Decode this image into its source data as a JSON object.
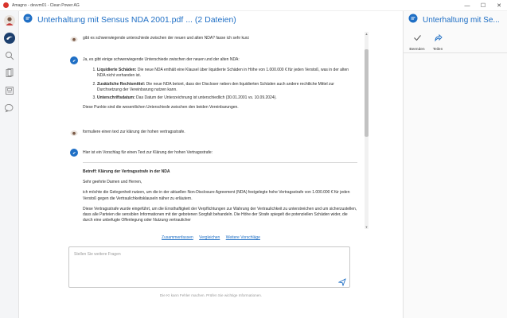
{
  "window": {
    "title": "Amagno - devvm01 - Clean Power AG",
    "controls": {
      "minimize": "—",
      "maximize": "☐",
      "close": "✕"
    }
  },
  "leftnav": {
    "items": [
      {
        "name": "avatar"
      },
      {
        "name": "amagno-logo-icon"
      },
      {
        "name": "search-icon"
      },
      {
        "name": "documents-icon"
      },
      {
        "name": "scanner-icon"
      },
      {
        "name": "chat-icon"
      }
    ]
  },
  "chat": {
    "title": "Unterhaltung mit Sensus NDA 2001.pdf ... (2 Dateien)",
    "messages": {
      "user1": "gibt es schwerwiegende unterschiede zwischen der neuen und alten NDA? fasse ich sehr kurz",
      "bot1_intro": "Ja, es gibt einige schwerwiegende Unterschiede zwischen der neuen und der alten NDA:",
      "bot1_items": [
        {
          "label": "Liquidierte Schäden:",
          "text": " Die neue NDA enthält eine Klausel über liquidierte Schäden in Höhe von 1.000.000 € für jeden Verstoß, was in der alten NDA nicht vorhanden ist."
        },
        {
          "label": "Zusätzliche Rechtsmittel:",
          "text": " Die neue NDA betont, dass der Discloser neben den liquidierten Schäden auch andere rechtliche Mittel zur Durchsetzung der Vereinbarung nutzen kann."
        },
        {
          "label": "Unterschriftsdatum:",
          "text": " Das Datum der Unterzeichnung ist unterschiedlich (30.01.2001 vs. 10.09.2024)."
        }
      ],
      "bot1_outro": "Diese Punkte sind die wesentlichen Unterschiede zwischen den beiden Vereinbarungen.",
      "user2": "formuliere einen text zur klärung der hohen vertragsstrafe.",
      "bot2_intro": "Hier ist ein Vorschlag für einen Text zur Klärung der hohen Vertragsstrafe:",
      "letter_subject": "Betreff: Klärung der Vertragsstrafe in der NDA",
      "letter_salutation": "Sehr geehrte Damen und Herren,",
      "letter_p1": "ich möchte die Gelegenheit nutzen, um die in der aktuellen Non-Disclosure Agreement (NDA) festgelegte hohe Vertragsstrafe von 1.000.000 € für jeden Verstoß gegen die Vertraulichkeitsklauseln näher zu erläutern.",
      "letter_p2": "Diese Vertragsstrafe wurde eingeführt, um die Ernsthaftigkeit der Verpflichtungen zur Wahrung der Vertraulichkeit zu unterstreichen und um sicherzustellen, dass alle Parteien die sensiblen Informationen mit der gebotenen Sorgfalt behandeln. Die Höhe der Strafe spiegelt die potenziellen Schäden wider, die durch eine unbefugte Offenlegung oder Nutzung vertraulicher"
    },
    "suggestions": [
      "Zusammenfassen",
      "Vergleichen",
      "Weitere Vorschläge"
    ],
    "input": {
      "placeholder": "Stellen Sie weitere Fragen"
    },
    "disclaimer": "Die KI kann Fehler machen. Prüfen Sie wichtige Informationen."
  },
  "rightpanel": {
    "title": "Unterhaltung mit Se...",
    "actions": [
      {
        "label": "Beenden",
        "icon": "checkmark-icon"
      },
      {
        "label": "Teilen",
        "icon": "share-icon"
      }
    ]
  },
  "colors": {
    "accent": "#1f6fc5",
    "brand_red": "#d8342c"
  }
}
